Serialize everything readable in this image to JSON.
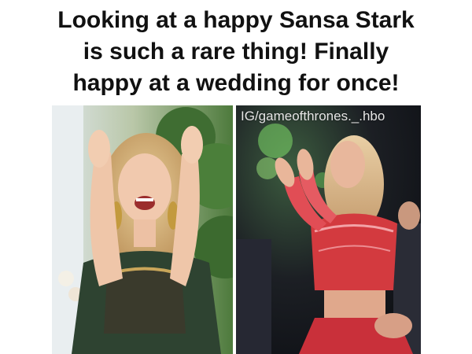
{
  "meme": {
    "caption_lines": [
      "Looking at a happy Sansa Stark",
      "is such a rare thing! Finally",
      "happy at a wedding for once!"
    ]
  },
  "photos": {
    "left": {
      "description_icon": "woman-clapping-photo"
    },
    "right": {
      "description_icon": "woman-dancing-photo",
      "watermark": "IG/gameofthrones._.hbo"
    }
  },
  "colors": {
    "caption_text": "#111111",
    "background": "#ffffff"
  }
}
